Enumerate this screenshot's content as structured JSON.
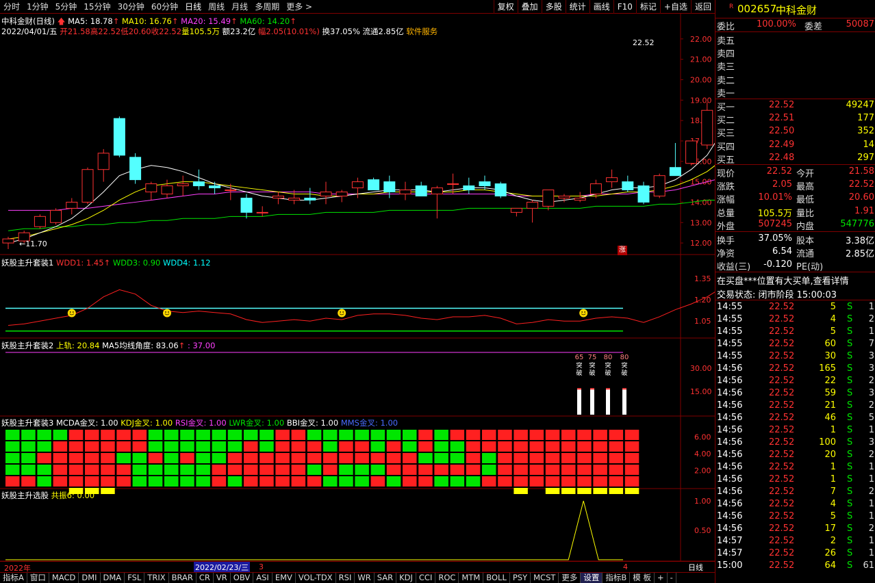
{
  "toolbar": {
    "tabs": [
      "分时",
      "1分钟",
      "5分钟",
      "15分钟",
      "30分钟",
      "60分钟",
      "日线",
      "周线",
      "月线",
      "多周期",
      "更多"
    ],
    "active": "日线",
    "buttons": [
      "复权",
      "叠加",
      "多股",
      "统计",
      "画线",
      "F10",
      "标记",
      "+自选",
      "返回"
    ]
  },
  "main": {
    "title": "中科金财(日线)",
    "ma5": "MA5: 18.78",
    "ma10": "MA10: 16.76",
    "ma20": "MA20: 15.49",
    "ma60": "MA60: 14.20",
    "date": "2022/04/01/五",
    "open": "开21.58",
    "high": "高22.52",
    "low": "低20.60",
    "close": "收22.52",
    "vol": "量105.5万",
    "amt": "额23.2亿",
    "chg": "幅2.05(10.01%)",
    "turn": "换37.05%",
    "float": "流通2.85亿",
    "sector": "软件服务",
    "max_label": "22.52",
    "min_label": "11.70",
    "limit_badge": "涨",
    "yticks": [
      "22.00",
      "21.00",
      "20.00",
      "19.00",
      "18.00",
      "17.00",
      "16.00",
      "15.00",
      "14.00",
      "13.00",
      "12.00"
    ]
  },
  "p1": {
    "name": "妖股主升套装1",
    "wdd1": "WDD1: 1.45",
    "wdd3": "WDD3: 0.90",
    "wdd4": "WDD4: 1.12",
    "yticks": [
      "1.35",
      "1.20",
      "1.05"
    ]
  },
  "p2": {
    "name": "妖股主升套装2",
    "up": "上轨: 20.84",
    "angle": "MA5均线角度: 83.06",
    "val": ": 37.00",
    "yticks": [
      "30.00",
      "15.00"
    ],
    "bars": [
      {
        "n": "65",
        "t": "突破"
      },
      {
        "n": "75",
        "t": "突破"
      },
      {
        "n": "80",
        "t": "突破"
      },
      {
        "n": "80",
        "t": "突破"
      }
    ]
  },
  "p3": {
    "name": "妖股主升套装3",
    "macd": "MCDA金叉: 1.00",
    "kdj": "KDJ金叉: 1.00",
    "rsi": "RSI金叉: 1.00",
    "lwr": "LWR金叉: 1.00",
    "bbi": "BBI金叉: 1.00",
    "mms": "MMS金叉: 1.00",
    "yticks": [
      "6.00",
      "4.00",
      "2.00"
    ]
  },
  "p4": {
    "name": "妖股主升选股",
    "gz": "共振6: 0.00",
    "yticks": [
      "1.00",
      "0.50"
    ]
  },
  "xaxis": {
    "year": "2022年",
    "cursor": "2022/02/23/三",
    "m3": "3",
    "m4": "4",
    "period": "日线"
  },
  "bottom": {
    "tabs": [
      "指标A",
      "窗口",
      "MACD",
      "DMI",
      "DMA",
      "FSL",
      "TRIX",
      "BRAR",
      "CR",
      "VR",
      "OBV",
      "ASI",
      "EMV",
      "VOL-TDX",
      "RSI",
      "WR",
      "SAR",
      "KDJ",
      "CCI",
      "ROC",
      "MTM",
      "BOLL",
      "PSY",
      "MCST",
      "更多",
      "设置",
      "指标B",
      "模 板",
      "+",
      "-"
    ]
  },
  "quote": {
    "code": "002657",
    "name": "中科金财",
    "r": "R",
    "wb_label": "委比",
    "wb": "100.00%",
    "wc_label": "委差",
    "wc": "50087",
    "sells": [
      "卖五",
      "卖四",
      "卖三",
      "卖二",
      "卖一"
    ],
    "buys": [
      {
        "l": "买一",
        "p": "22.52",
        "v": "49247"
      },
      {
        "l": "买二",
        "p": "22.51",
        "v": "177"
      },
      {
        "l": "买三",
        "p": "22.50",
        "v": "352"
      },
      {
        "l": "买四",
        "p": "22.49",
        "v": "14"
      },
      {
        "l": "买五",
        "p": "22.48",
        "v": "297"
      }
    ],
    "stats": [
      {
        "a": "现价",
        "b": "22.52",
        "c": "今开",
        "d": "21.58"
      },
      {
        "a": "涨跌",
        "b": "2.05",
        "c": "最高",
        "d": "22.52"
      },
      {
        "a": "涨幅",
        "b": "10.01%",
        "c": "最低",
        "d": "20.60"
      },
      {
        "a": "总量",
        "b": "105.5万",
        "c": "量比",
        "d": "1.91"
      },
      {
        "a": "外盘",
        "b": "507245",
        "c": "内盘",
        "d": "547776"
      }
    ],
    "stats2": [
      {
        "a": "换手",
        "b": "37.05%",
        "c": "股本",
        "d": "3.38亿"
      },
      {
        "a": "净资",
        "b": "6.54",
        "c": "流通",
        "d": "2.85亿"
      },
      {
        "a": "收益(三)",
        "b": "-0.120",
        "c": "PE(动)",
        "d": ""
      }
    ],
    "notice": "在买盘***位置有大买单,查看详情",
    "status": "交易状态: 闭市阶段 15:00:03",
    "ticks": [
      [
        "14:55",
        "22.52",
        "5",
        "S",
        "1"
      ],
      [
        "14:55",
        "22.52",
        "4",
        "S",
        "2"
      ],
      [
        "14:55",
        "22.52",
        "5",
        "S",
        "1"
      ],
      [
        "14:55",
        "22.52",
        "60",
        "S",
        "7"
      ],
      [
        "14:55",
        "22.52",
        "30",
        "S",
        "3"
      ],
      [
        "14:56",
        "22.52",
        "165",
        "S",
        "3"
      ],
      [
        "14:56",
        "22.52",
        "22",
        "S",
        "2"
      ],
      [
        "14:56",
        "22.52",
        "59",
        "S",
        "3"
      ],
      [
        "14:56",
        "22.52",
        "21",
        "S",
        "2"
      ],
      [
        "14:56",
        "22.52",
        "46",
        "S",
        "5"
      ],
      [
        "14:56",
        "22.52",
        "1",
        "S",
        "1"
      ],
      [
        "14:56",
        "22.52",
        "100",
        "S",
        "3"
      ],
      [
        "14:56",
        "22.52",
        "20",
        "S",
        "2"
      ],
      [
        "14:56",
        "22.52",
        "1",
        "S",
        "1"
      ],
      [
        "14:56",
        "22.52",
        "1",
        "S",
        "1"
      ],
      [
        "14:56",
        "22.52",
        "7",
        "S",
        "2"
      ],
      [
        "14:56",
        "22.52",
        "4",
        "S",
        "1"
      ],
      [
        "14:56",
        "22.52",
        "5",
        "S",
        "1"
      ],
      [
        "14:56",
        "22.52",
        "17",
        "S",
        "2"
      ],
      [
        "14:57",
        "22.52",
        "2",
        "S",
        "1"
      ],
      [
        "14:57",
        "22.52",
        "26",
        "S",
        "1"
      ],
      [
        "15:00",
        "22.52",
        "64",
        "S",
        "61"
      ]
    ]
  },
  "colors": {
    "up": "#ff3232",
    "down": "#54ffff",
    "grid": "#800000",
    "ma5": "#ffffff",
    "ma10": "#ffff00",
    "ma20": "#ff40ff",
    "ma60": "#00e600"
  },
  "chart_data": {
    "type": "candlestick",
    "candles": [
      [
        12.0,
        12.3,
        11.7,
        12.2
      ],
      [
        12.1,
        12.6,
        12.0,
        12.5
      ],
      [
        12.8,
        13.4,
        12.7,
        13.3
      ],
      [
        13.0,
        13.7,
        12.9,
        13.6
      ],
      [
        13.7,
        14.2,
        13.4,
        14.0
      ],
      [
        14.0,
        15.7,
        13.9,
        15.6
      ],
      [
        15.6,
        16.6,
        15.0,
        16.4
      ],
      [
        18.1,
        18.2,
        16.2,
        16.3
      ],
      [
        16.2,
        16.4,
        14.9,
        15.1
      ],
      [
        14.5,
        15.0,
        14.1,
        14.9
      ],
      [
        14.4,
        15.1,
        14.2,
        14.8
      ],
      [
        14.8,
        15.3,
        14.3,
        14.9
      ],
      [
        15.0,
        15.6,
        14.6,
        14.8
      ],
      [
        14.8,
        15.0,
        14.4,
        14.7
      ],
      [
        14.6,
        14.9,
        14.1,
        14.6
      ],
      [
        14.2,
        14.4,
        13.2,
        13.5
      ],
      [
        13.5,
        13.8,
        13.3,
        13.5
      ],
      [
        14.2,
        14.5,
        13.9,
        14.3
      ],
      [
        14.1,
        14.6,
        13.9,
        14.2
      ],
      [
        14.2,
        14.7,
        13.9,
        14.1
      ],
      [
        14.3,
        15.0,
        13.9,
        14.5
      ],
      [
        14.3,
        14.6,
        14.0,
        14.5
      ],
      [
        14.7,
        15.2,
        14.2,
        15.0
      ],
      [
        15.1,
        15.2,
        14.6,
        14.6
      ],
      [
        15.0,
        15.3,
        14.2,
        14.5
      ],
      [
        14.4,
        15.0,
        14.1,
        14.6
      ],
      [
        14.8,
        15.0,
        14.3,
        14.3
      ],
      [
        14.4,
        14.8,
        13.2,
        14.7
      ],
      [
        14.9,
        15.4,
        14.4,
        14.9
      ],
      [
        14.8,
        15.2,
        14.4,
        14.6
      ],
      [
        15.0,
        15.3,
        14.6,
        14.8
      ],
      [
        14.9,
        15.0,
        14.2,
        14.3
      ],
      [
        13.5,
        13.7,
        13.3,
        13.7
      ],
      [
        13.7,
        14.1,
        13.0,
        14.0
      ],
      [
        13.8,
        14.6,
        13.6,
        14.6
      ],
      [
        14.2,
        14.4,
        14.0,
        14.3
      ],
      [
        14.1,
        14.5,
        14.0,
        14.2
      ],
      [
        14.4,
        15.1,
        14.2,
        14.9
      ],
      [
        15.0,
        15.6,
        14.7,
        15.2
      ],
      [
        15.0,
        15.3,
        14.5,
        14.6
      ],
      [
        14.8,
        15.0,
        13.9,
        14.0
      ],
      [
        14.3,
        15.4,
        14.2,
        15.3
      ],
      [
        15.7,
        16.9,
        15.4,
        15.3
      ],
      [
        15.9,
        17.0,
        15.8,
        17.0
      ],
      [
        16.8,
        18.9,
        16.6,
        18.5
      ],
      [
        18.6,
        20.5,
        18.3,
        20.4
      ],
      [
        20.6,
        22.52,
        20.6,
        22.5
      ]
    ],
    "ma5": [
      12.0,
      12.2,
      12.5,
      12.8,
      13.2,
      13.8,
      14.5,
      15.3,
      15.6,
      15.8,
      15.7,
      15.5,
      15.2,
      14.9,
      14.7,
      14.5,
      14.3,
      14.2,
      14.1,
      14.1,
      14.2,
      14.3,
      14.4,
      14.5,
      14.6,
      14.6,
      14.6,
      14.5,
      14.6,
      14.7,
      14.7,
      14.6,
      14.3,
      14.1,
      14.0,
      14.1,
      14.2,
      14.4,
      14.6,
      14.7,
      14.7,
      14.8,
      15.1,
      15.6,
      16.3,
      17.5,
      18.8
    ],
    "ma10": [
      12.2,
      12.3,
      12.5,
      12.7,
      12.9,
      13.2,
      13.6,
      14.1,
      14.5,
      14.8,
      14.9,
      15.0,
      15.0,
      14.9,
      14.8,
      14.7,
      14.6,
      14.5,
      14.4,
      14.4,
      14.3,
      14.3,
      14.4,
      14.4,
      14.5,
      14.5,
      14.5,
      14.5,
      14.5,
      14.6,
      14.6,
      14.5,
      14.4,
      14.3,
      14.3,
      14.3,
      14.3,
      14.3,
      14.4,
      14.5,
      14.5,
      14.6,
      14.8,
      15.1,
      15.5,
      16.1,
      16.8
    ],
    "ma20": [
      13.6,
      13.6,
      13.6,
      13.6,
      13.7,
      13.7,
      13.8,
      13.9,
      14.0,
      14.1,
      14.2,
      14.3,
      14.4,
      14.4,
      14.5,
      14.5,
      14.5,
      14.5,
      14.5,
      14.5,
      14.4,
      14.4,
      14.4,
      14.4,
      14.4,
      14.4,
      14.4,
      14.4,
      14.4,
      14.4,
      14.4,
      14.4,
      14.3,
      14.3,
      14.3,
      14.3,
      14.3,
      14.4,
      14.4,
      14.4,
      14.5,
      14.5,
      14.6,
      14.8,
      15.0,
      15.2,
      15.5
    ],
    "ma60": [
      12.6,
      12.7,
      12.7,
      12.8,
      12.8,
      12.9,
      12.9,
      13.0,
      13.0,
      13.1,
      13.1,
      13.2,
      13.2,
      13.2,
      13.3,
      13.3,
      13.3,
      13.4,
      13.4,
      13.4,
      13.5,
      13.5,
      13.5,
      13.5,
      13.6,
      13.6,
      13.6,
      13.6,
      13.6,
      13.7,
      13.7,
      13.7,
      13.7,
      13.7,
      13.7,
      13.7,
      13.7,
      13.8,
      13.8,
      13.8,
      13.8,
      13.9,
      13.9,
      14.0,
      14.1,
      14.1,
      14.2
    ],
    "ylim": [
      11.5,
      22.9
    ],
    "p1_line": [
      1.02,
      1.03,
      1.05,
      1.07,
      1.09,
      1.14,
      1.22,
      1.27,
      1.24,
      1.16,
      1.12,
      1.11,
      1.12,
      1.11,
      1.1,
      1.06,
      1.04,
      1.05,
      1.06,
      1.05,
      1.07,
      1.06,
      1.09,
      1.1,
      1.1,
      1.09,
      1.07,
      1.06,
      1.08,
      1.08,
      1.09,
      1.07,
      1.03,
      1.04,
      1.06,
      1.05,
      1.05,
      1.07,
      1.08,
      1.07,
      1.04,
      1.08,
      1.13,
      1.17,
      1.22,
      1.29,
      1.35,
      1.4
    ],
    "p1_ylim": [
      0.95,
      1.45
    ],
    "p1_cyan": 1.14,
    "p1_green": 0.98,
    "p1_smiles": [
      4,
      10,
      21,
      36
    ],
    "p2_bars": [
      {
        "i": 38,
        "v": 17
      },
      {
        "i": 39,
        "v": 17
      },
      {
        "i": 40,
        "v": 17
      },
      {
        "i": 41,
        "v": 17
      }
    ],
    "p3_cells": [
      [
        1,
        1,
        1,
        1,
        0,
        0,
        0,
        0,
        0,
        1,
        1,
        1,
        1,
        1,
        1,
        1,
        1,
        0,
        0,
        1,
        1,
        1,
        1,
        1,
        1,
        1,
        0,
        1,
        0,
        0,
        0,
        0,
        0,
        0,
        0,
        0,
        0,
        0,
        0,
        0
      ],
      [
        1,
        1,
        1,
        0,
        0,
        0,
        0,
        0,
        0,
        1,
        1,
        1,
        1,
        1,
        1,
        0,
        1,
        0,
        0,
        0,
        1,
        0,
        0,
        1,
        0,
        1,
        0,
        1,
        1,
        0,
        0,
        0,
        0,
        0,
        0,
        0,
        0,
        0,
        0,
        0
      ],
      [
        1,
        1,
        0,
        0,
        0,
        0,
        0,
        1,
        1,
        0,
        1,
        0,
        1,
        1,
        0,
        0,
        0,
        0,
        0,
        0,
        0,
        0,
        0,
        0,
        0,
        0,
        1,
        1,
        1,
        0,
        1,
        0,
        0,
        0,
        0,
        0,
        0,
        0,
        0,
        0
      ],
      [
        1,
        1,
        1,
        0,
        0,
        0,
        0,
        0,
        1,
        1,
        1,
        1,
        1,
        0,
        0,
        0,
        0,
        0,
        0,
        1,
        0,
        1,
        1,
        1,
        0,
        0,
        0,
        0,
        0,
        0,
        1,
        0,
        0,
        0,
        0,
        0,
        0,
        0,
        0,
        0
      ],
      [
        0,
        0,
        1,
        0,
        0,
        0,
        0,
        0,
        1,
        1,
        1,
        1,
        1,
        0,
        1,
        0,
        0,
        0,
        0,
        0,
        1,
        1,
        1,
        0,
        1,
        0,
        0,
        1,
        1,
        1,
        0,
        0,
        0,
        0,
        0,
        0,
        0,
        0,
        0,
        0
      ]
    ],
    "p3_yellow": [
      4,
      5,
      6,
      32,
      34,
      35,
      36,
      37,
      38,
      39
    ],
    "p4_peak": 36
  }
}
